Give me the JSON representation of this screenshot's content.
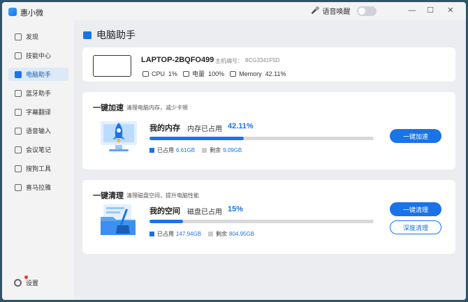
{
  "app": {
    "title": "惠小微",
    "voice_wake_label": "语音唤醒",
    "voice_wake_on": false
  },
  "window_controls": {
    "minimize": "—",
    "maximize": "☐",
    "close": "✕"
  },
  "sidebar": {
    "items": [
      {
        "label": "发现",
        "icon": "compass-icon"
      },
      {
        "label": "技能中心",
        "icon": "puzzle-icon"
      },
      {
        "label": "电脑助手",
        "icon": "monitor-icon",
        "active": true
      },
      {
        "label": "蓝牙助手",
        "icon": "bluetooth-icon"
      },
      {
        "label": "字幕翻译",
        "icon": "subtitle-icon"
      },
      {
        "label": "语音输入",
        "icon": "microphone-icon"
      },
      {
        "label": "会议笔记",
        "icon": "notes-icon"
      },
      {
        "label": "搜狗工具",
        "icon": "toolbox-icon"
      },
      {
        "label": "喜马拉雅",
        "icon": "headphones-icon"
      }
    ],
    "settings_label": "设置"
  },
  "page": {
    "title": "电脑助手"
  },
  "device": {
    "name": "LAPTOP-2BQFO499",
    "host_label": "主机编号：",
    "host_id": "8CG3341F5D",
    "cpu_label": "CPU",
    "cpu_value": "1%",
    "battery_label": "电量",
    "battery_value": "100%",
    "memory_label": "Memory",
    "memory_value": "42.11%"
  },
  "speedup": {
    "title": "一键加速",
    "subtitle": "清理电脑内存，减少卡顿",
    "usage_title": "我的内存",
    "usage_label": "内存已占用",
    "usage_pct": "42.11%",
    "usage_fraction": 0.4211,
    "used_label": "已占用",
    "used_value": "6.61GB",
    "free_label": "剩余",
    "free_value": "9.09GB",
    "button": "一键加速"
  },
  "clean": {
    "title": "一键清理",
    "subtitle": "清理磁盘空间，提升电脑性能",
    "usage_title": "我的空间",
    "usage_label": "磁盘已占用",
    "usage_pct": "15%",
    "usage_fraction": 0.15,
    "used_label": "已占用",
    "used_value": "147.94GB",
    "free_label": "剩余",
    "free_value": "804.95GB",
    "button": "一键清理",
    "deep_button": "深度清理"
  },
  "colors": {
    "accent": "#1a73e8",
    "track": "#d9d9d9",
    "used_swatch": "#1a73e8",
    "free_swatch": "#cccccc"
  }
}
